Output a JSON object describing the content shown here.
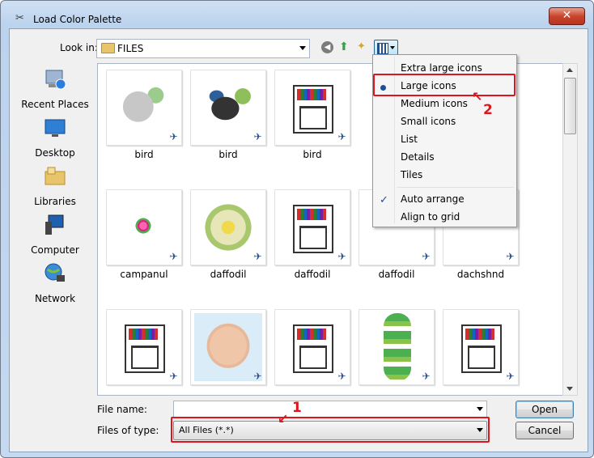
{
  "window": {
    "title": "Load Color Palette",
    "close_symbol": "✕"
  },
  "toolbar": {
    "lookin_label": "Look in:",
    "lookin_value": "FILES"
  },
  "places": [
    {
      "label": "Recent Places",
      "icon": "recent-places-icon"
    },
    {
      "label": "Desktop",
      "icon": "desktop-icon"
    },
    {
      "label": "Libraries",
      "icon": "libraries-icon"
    },
    {
      "label": "Computer",
      "icon": "computer-icon"
    },
    {
      "label": "Network",
      "icon": "network-icon"
    }
  ],
  "files": [
    {
      "name": "bird",
      "thumb": "bird-color"
    },
    {
      "name": "bird",
      "thumb": "bird-bw"
    },
    {
      "name": "bird",
      "thumb": "doc"
    },
    {
      "name": "campanul",
      "thumb": "flower"
    },
    {
      "name": "daffodil",
      "thumb": "daffodil"
    },
    {
      "name": "daffodil",
      "thumb": "doc"
    },
    {
      "name": "daffodil",
      "thumb": "hidden"
    },
    {
      "name": "dachshnd",
      "thumb": "hidden"
    },
    {
      "name": "",
      "thumb": "doc"
    },
    {
      "name": "",
      "thumb": "baby"
    },
    {
      "name": "",
      "thumb": "doc"
    },
    {
      "name": "",
      "thumb": "ivy"
    },
    {
      "name": "",
      "thumb": "doc"
    }
  ],
  "view_menu": {
    "items": [
      "Extra large icons",
      "Large icons",
      "Medium icons",
      "Small icons",
      "List",
      "Details",
      "Tiles"
    ],
    "options": [
      "Auto arrange",
      "Align to grid"
    ],
    "selected": "Large icons",
    "checked": "Auto arrange"
  },
  "bottom": {
    "filename_label": "File name:",
    "filename_value": "",
    "filetype_label": "Files of type:",
    "filetype_value": "All Files (*.*)",
    "open_label": "Open",
    "cancel_label": "Cancel"
  },
  "annotations": {
    "one": "1",
    "two": "2",
    "color": "#e0141c"
  }
}
